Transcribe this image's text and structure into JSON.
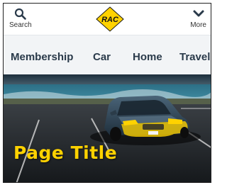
{
  "header": {
    "search_label": "Search",
    "more_label": "More",
    "logo_text": "RAC"
  },
  "nav": {
    "items": [
      {
        "label": "Membership"
      },
      {
        "label": "Car"
      },
      {
        "label": "Home"
      },
      {
        "label": "Travel"
      }
    ]
  },
  "hero": {
    "title": "Page Title",
    "title_color": "#ffd200"
  },
  "colors": {
    "brand_yellow": "#ffd200",
    "nav_background": "#f2f4f6",
    "nav_text": "#2a3a4a"
  },
  "icons": {
    "search": "search-icon",
    "more": "chevron-down-icon",
    "logo": "rac-logo"
  }
}
